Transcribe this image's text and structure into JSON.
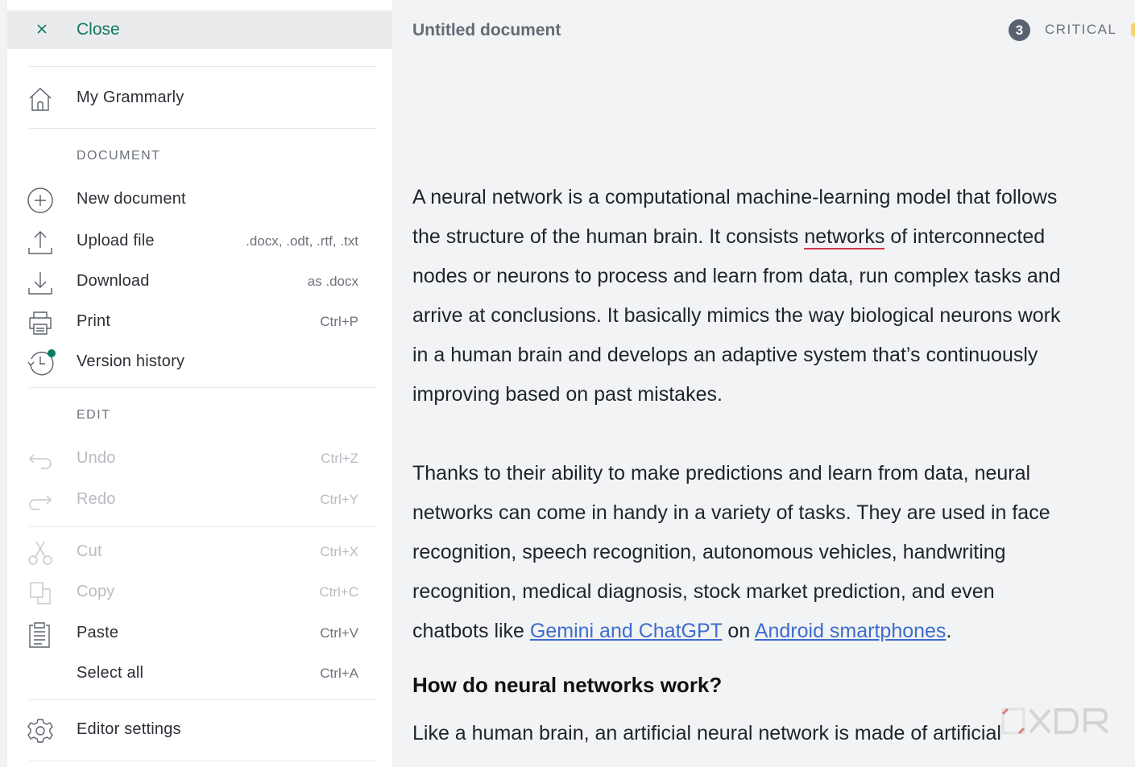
{
  "menu": {
    "close_label": "Close",
    "my_grammarly": "My Grammarly",
    "section_document": "DOCUMENT",
    "new_document": "New document",
    "upload_file": "Upload file",
    "upload_hint": ".docx, .odt, .rtf, .txt",
    "download": "Download",
    "download_hint": "as .docx",
    "print": "Print",
    "print_hint": "Ctrl+P",
    "version_history": "Version history",
    "section_edit": "EDIT",
    "undo": "Undo",
    "undo_hint": "Ctrl+Z",
    "redo": "Redo",
    "redo_hint": "Ctrl+Y",
    "cut": "Cut",
    "cut_hint": "Ctrl+X",
    "copy": "Copy",
    "copy_hint": "Ctrl+C",
    "paste": "Paste",
    "paste_hint": "Ctrl+V",
    "select_all": "Select all",
    "select_all_hint": "Ctrl+A",
    "editor_settings": "Editor settings"
  },
  "editor": {
    "title": "Untitled document",
    "critical_count": "3",
    "critical_label": "CRITICAL",
    "para1": {
      "l1": "A neural network is a computational machine-learning model that follows",
      "l2_pre": "the structure of the human brain. It consists ",
      "l2_err": "networks",
      "l2_post": " of interconnected",
      "l3": "nodes or neurons to process and learn from data, run complex tasks and",
      "l4": "arrive at conclusions. It basically mimics the way biological neurons work",
      "l5": "in a human brain and develops an adaptive system that’s continuously",
      "l6": "improving based on past mistakes."
    },
    "para2": {
      "l1": "Thanks to their ability to make predictions and learn from data, neural",
      "l2": "networks can come in handy in a variety of tasks. They are used in face",
      "l3": "recognition, speech recognition, autonomous vehicles, handwriting",
      "l4": "recognition, medical diagnosis, stock market prediction, and even",
      "l5_pre": "chatbots like ",
      "l5_link1": "Gemini and ChatGPT",
      "l5_mid": " on ",
      "l5_link2": "Android smartphones",
      "l5_post": "."
    },
    "heading": "How do neural networks work?",
    "para3": {
      "l1": "Like a human brain, an artificial neural network is made of artificial"
    }
  },
  "colors": {
    "accent": "#0f7a64",
    "error_underline": "#d0344a",
    "link": "#3d6dcc"
  }
}
